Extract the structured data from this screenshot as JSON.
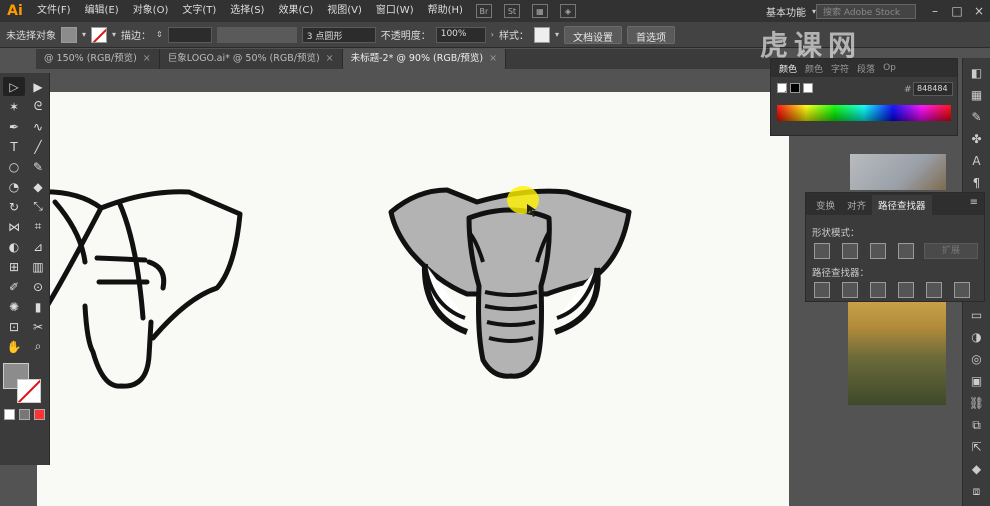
{
  "app": {
    "logo": "Ai"
  },
  "menu": [
    "文件(F)",
    "编辑(E)",
    "对象(O)",
    "文字(T)",
    "选择(S)",
    "效果(C)",
    "视图(V)",
    "窗口(W)",
    "帮助(H)"
  ],
  "menubar_right": {
    "workspace": "基本功能",
    "search_placeholder": "搜索 Adobe Stock"
  },
  "control": {
    "selection_label": "未选择对象",
    "stroke_label": "描边：",
    "brush_field": "3 点圆形",
    "opacity_label": "不透明度：",
    "opacity_value": "100%",
    "style_label": "样式：",
    "doc_settings": "文档设置",
    "preferences": "首选项"
  },
  "tabs": [
    {
      "label": "@ 150% (RGB/预览)"
    },
    {
      "label": "巨象LOGO.ai* @ 50% (RGB/预览)"
    },
    {
      "label": "未标题-2* @ 90% (RGB/预览)"
    }
  ],
  "color_panel": {
    "tabs": [
      "颜色",
      "颜色",
      "字符",
      "段落",
      "Op"
    ],
    "hex_label": "#",
    "hex_value": "848484"
  },
  "pathfinder": {
    "tabs": [
      "变换",
      "对齐",
      "路径查找器"
    ],
    "shape_modes": "形状模式：",
    "pathfinders": "路径查找器：",
    "expand": "扩展"
  },
  "watermark": "虎课网",
  "colors": {
    "fill": "#8c8c8c",
    "elephant_gray": "#b3b3b3",
    "outline": "#111111",
    "accent": "#ff9a00"
  }
}
